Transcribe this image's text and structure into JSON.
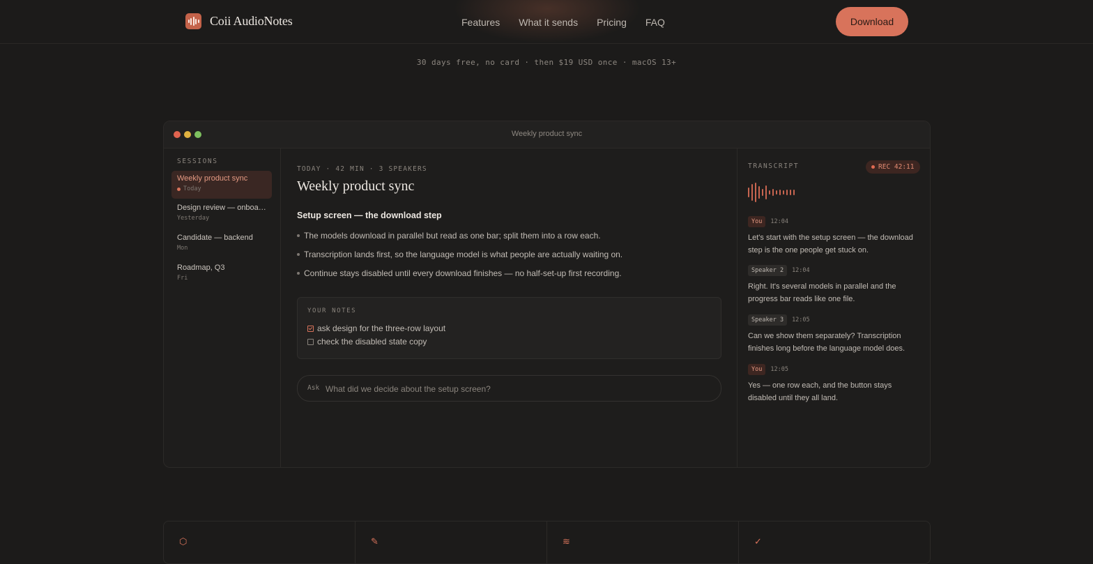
{
  "brand": {
    "name": "Coii AudioNotes",
    "accent": "#d8735b"
  },
  "nav": {
    "items": [
      "Features",
      "What it sends",
      "Pricing",
      "FAQ"
    ],
    "download_label": "Download"
  },
  "tagline": "30 days free, no card · then $19 USD once · macOS 13+",
  "window": {
    "title": "Weekly product sync"
  },
  "sidebar": {
    "heading": "SESSIONS",
    "sessions": [
      {
        "title": "Weekly product sync",
        "sub": "Today",
        "active": true
      },
      {
        "title": "Design review — onboarding",
        "sub": "Yesterday"
      },
      {
        "title": "Candidate — backend",
        "sub": "Mon"
      },
      {
        "title": "Roadmap, Q3",
        "sub": "Fri"
      }
    ]
  },
  "main": {
    "meta": "TODAY · 42 MIN · 3 SPEAKERS",
    "title": "Weekly product sync",
    "section_heading": "Setup screen — the download step",
    "bullets": [
      "The models download in parallel but read as one bar; split them into a row each.",
      "Transcription lands first, so the language model is what people are actually waiting on.",
      "Continue stays disabled until every download finishes — no half-set-up first recording."
    ],
    "notes": {
      "heading": "YOUR NOTES",
      "items": [
        {
          "text": "ask design for the three-row layout",
          "checked": true
        },
        {
          "text": "check the disabled state copy",
          "checked": false
        }
      ]
    },
    "ask": {
      "label": "Ask",
      "placeholder": "What did we decide about the setup screen?"
    }
  },
  "transcript": {
    "heading": "TRANSCRIPT",
    "rec_label": "REC 42:11",
    "messages": [
      {
        "speaker": "You",
        "time": "12:04",
        "text": "Let's start with the setup screen — the download step is the one people get stuck on."
      },
      {
        "speaker": "Speaker 2",
        "time": "12:04",
        "text": "Right. It's several models in parallel and the progress bar reads like one file."
      },
      {
        "speaker": "Speaker 3",
        "time": "12:05",
        "text": "Can we show them separately? Transcription finishes long before the language model does."
      },
      {
        "speaker": "You",
        "time": "12:05",
        "text": "Yes — one row each, and the button stays disabled until they all land."
      }
    ]
  },
  "features": {
    "icons": [
      "shield-icon",
      "pen-icon",
      "wave-icon",
      "check-icon"
    ]
  }
}
